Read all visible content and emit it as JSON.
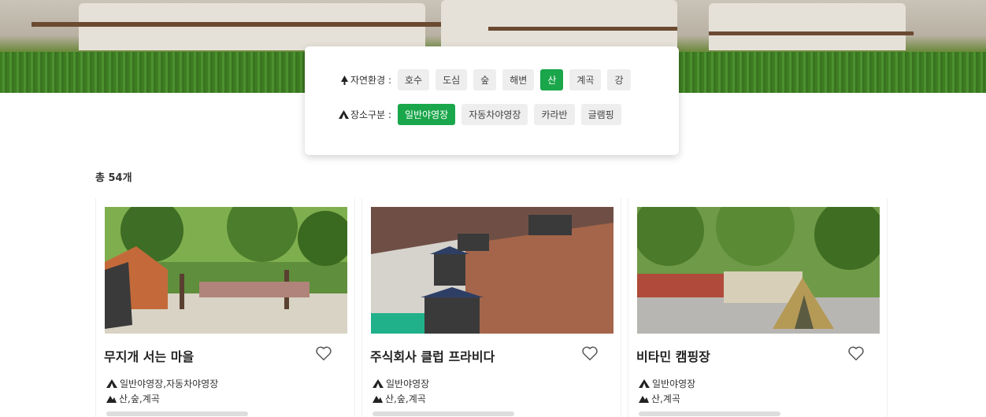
{
  "filters": {
    "nature": {
      "label": "자연환경 :",
      "options": [
        "호수",
        "도심",
        "숲",
        "해변",
        "산",
        "계곡",
        "강"
      ],
      "selected": "산"
    },
    "place": {
      "label": "장소구분 :",
      "options": [
        "일반야영장",
        "자동차야영장",
        "카라반",
        "글램핑"
      ],
      "selected": "일반야영장"
    }
  },
  "result_count": "총 54개",
  "cards": [
    {
      "title": "무지개 서는 마을",
      "type": "일반야영장,자동차야영장",
      "env": "산,숲,계곡"
    },
    {
      "title": "주식회사 클럽 프라비다",
      "type": "일반야영장",
      "env": "산,숲,계곡"
    },
    {
      "title": "비타민 캠핑장",
      "type": "일반야영장",
      "env": "산,계곡"
    }
  ],
  "colors": {
    "accent": "#1aa64a"
  },
  "icons": {
    "nature": "tree-icon",
    "place": "tent-icon",
    "favorite": "heart-icon"
  }
}
